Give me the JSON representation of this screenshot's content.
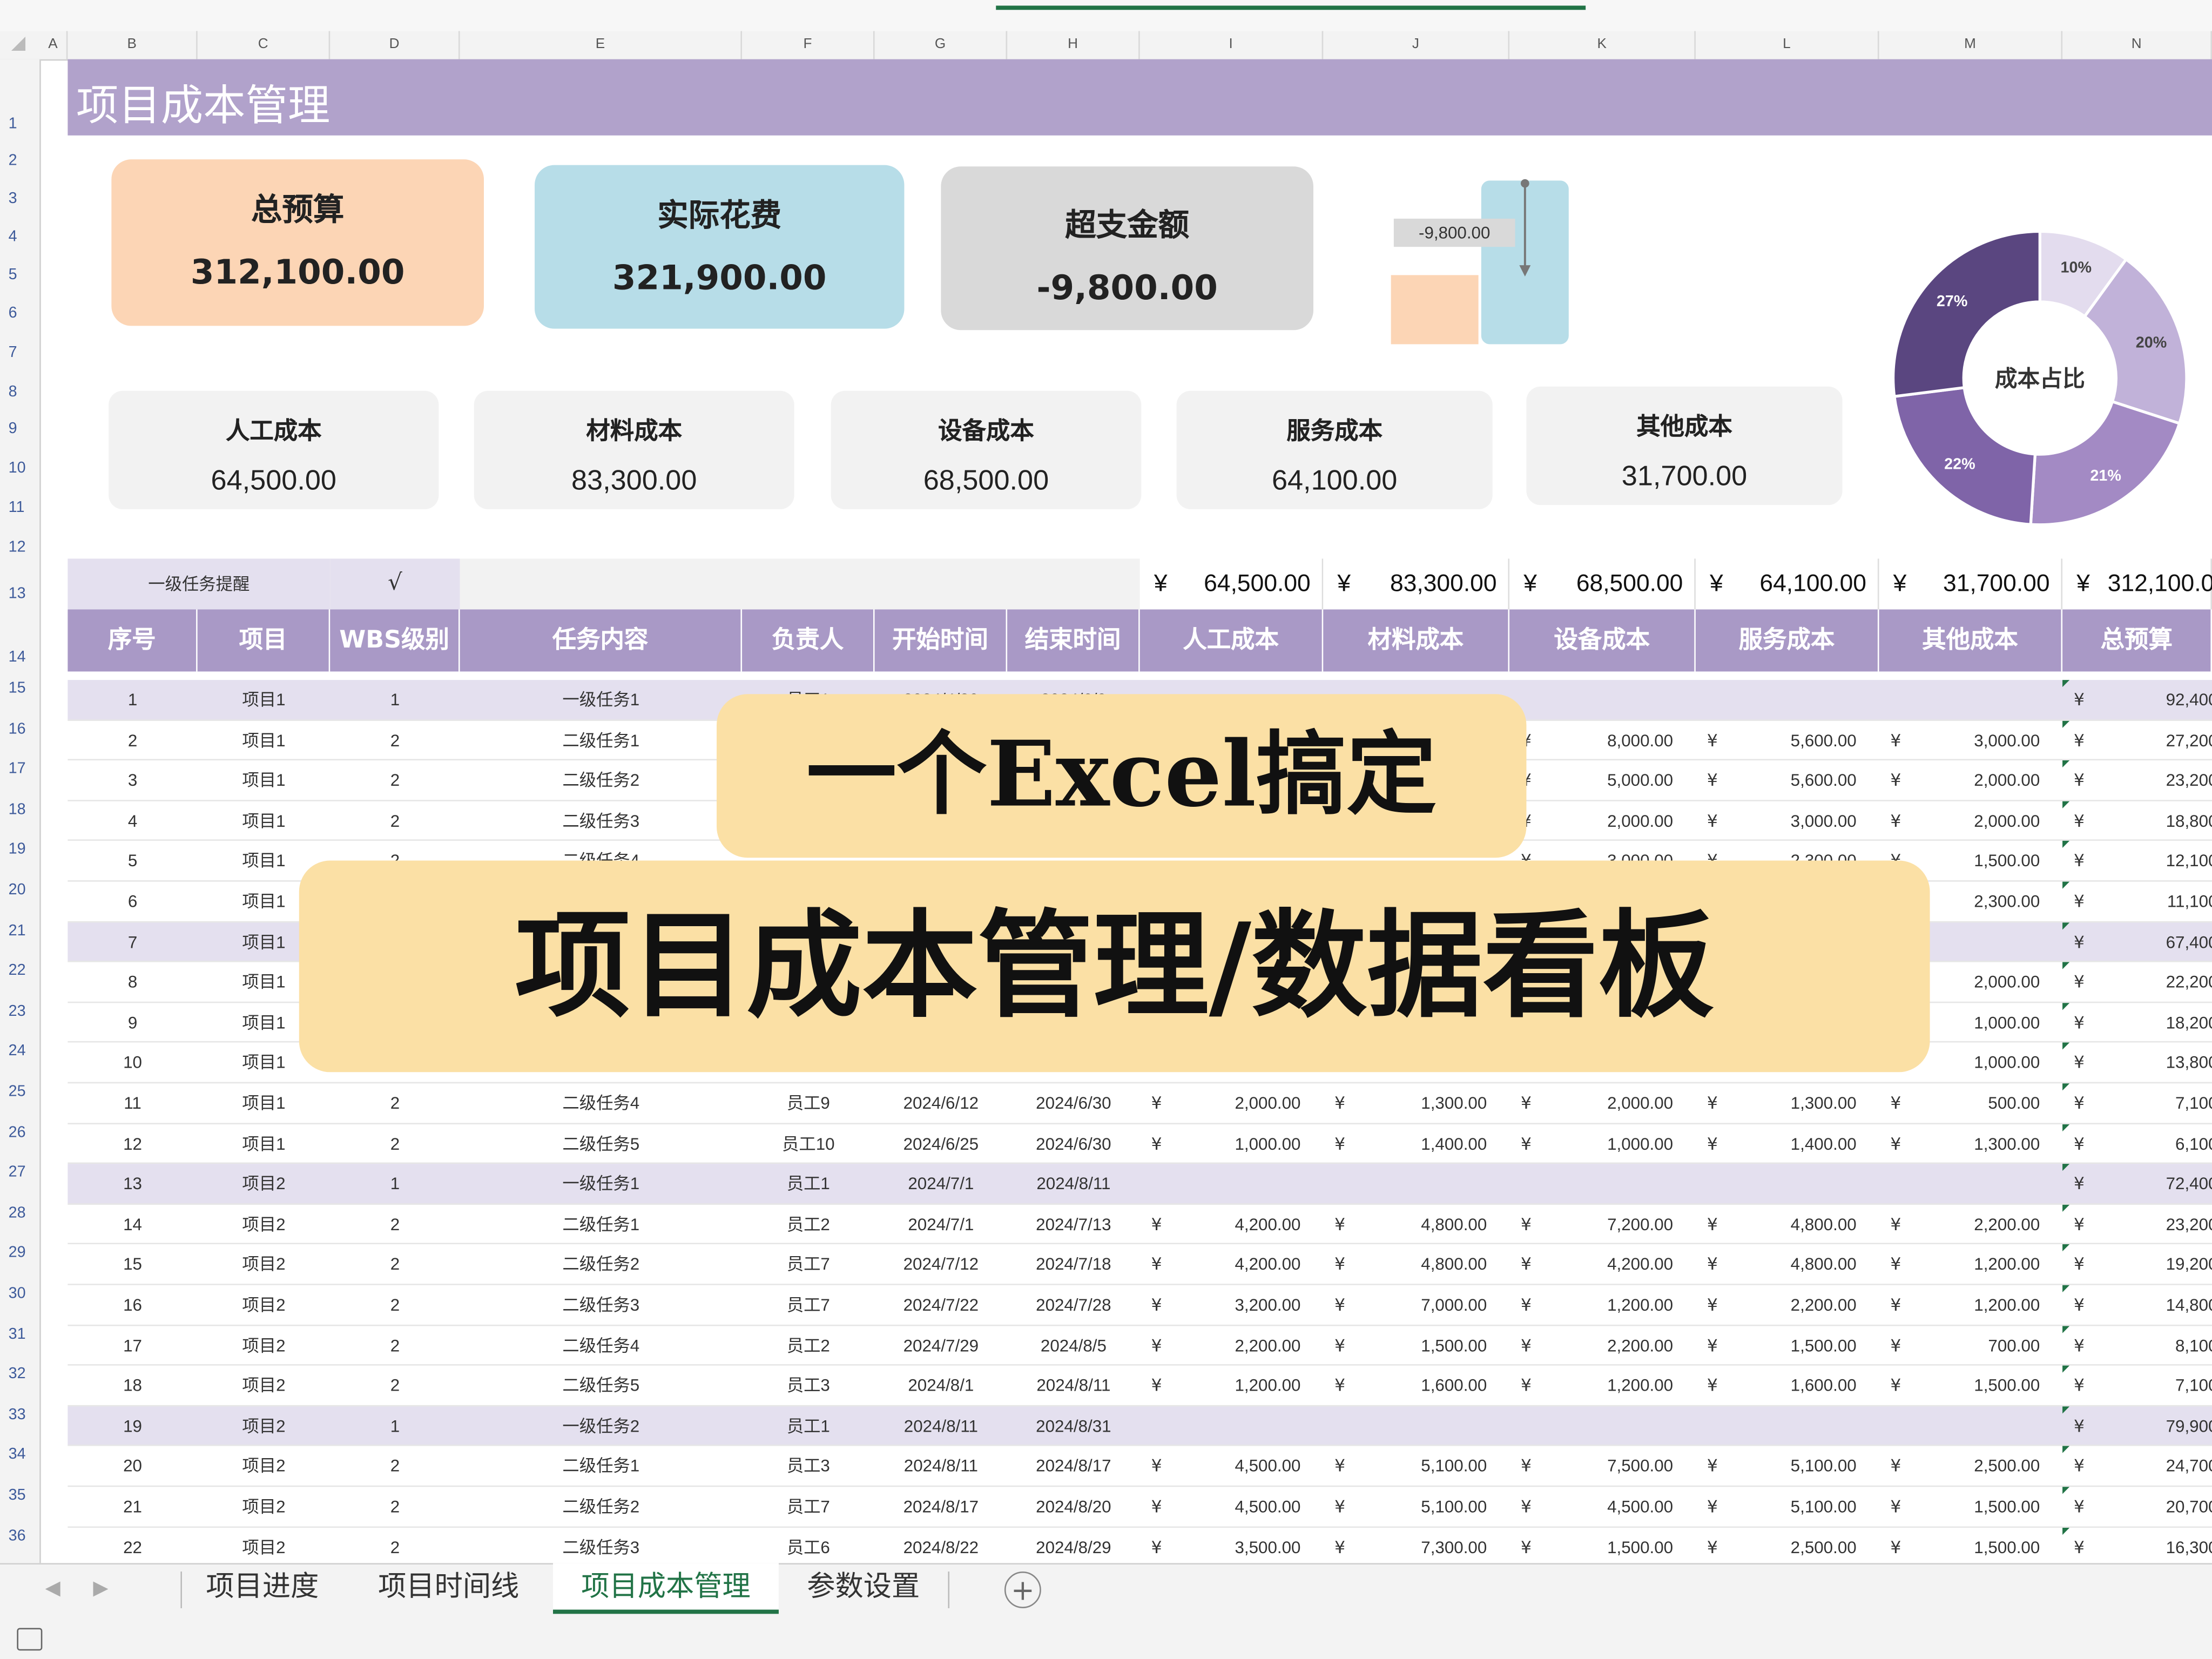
{
  "column_letters": [
    "A",
    "B",
    "C",
    "D",
    "E",
    "F",
    "G",
    "H",
    "I",
    "J",
    "K",
    "L",
    "M",
    "N"
  ],
  "row_numbers": [
    "1",
    "2",
    "3",
    "4",
    "5",
    "6",
    "7",
    "8",
    "9",
    "10",
    "11",
    "12",
    "13",
    "14",
    "15",
    "16",
    "17",
    "18",
    "19",
    "20",
    "21",
    "22",
    "23",
    "24",
    "25",
    "26",
    "27",
    "28",
    "29",
    "30",
    "31",
    "32",
    "33",
    "34",
    "35",
    "36"
  ],
  "title": "项目成本管理",
  "cards": [
    {
      "label": "总预算",
      "value": "312,100.00",
      "color": "#fcd5b5"
    },
    {
      "label": "实际花费",
      "value": "321,900.00",
      "color": "#b7dde8"
    },
    {
      "label": "超支金额",
      "value": "-9,800.00",
      "color": "#d9d9d9"
    }
  ],
  "bar_chart": {
    "label": "-9,800.00",
    "budget_fraction": 0.42,
    "actual_fraction": 1.0
  },
  "subcards": [
    {
      "label": "人工成本",
      "value": "64,500.00"
    },
    {
      "label": "材料成本",
      "value": "83,300.00"
    },
    {
      "label": "设备成本",
      "value": "68,500.00"
    },
    {
      "label": "服务成本",
      "value": "64,100.00"
    },
    {
      "label": "其他成本",
      "value": "31,700.00"
    }
  ],
  "donut": {
    "center_label": "成本占比",
    "slices": [
      {
        "label": "10%",
        "value": 10,
        "color": "#e3dcee"
      },
      {
        "label": "20%",
        "value": 20,
        "color": "#c1b2d9"
      },
      {
        "label": "21%",
        "value": 21,
        "color": "#a38ac4"
      },
      {
        "label": "22%",
        "value": 22,
        "color": "#7f64a8"
      },
      {
        "label": "27%",
        "value": 27,
        "color": "#5a4680"
      }
    ]
  },
  "table": {
    "filter_label": "一级任务提醒",
    "filter_check": "√",
    "totals_prefix": "¥",
    "totals": [
      "64,500.00",
      "83,300.00",
      "68,500.00",
      "64,100.00",
      "31,700.00",
      "312,100.00"
    ],
    "headers": [
      "序号",
      "项目",
      "WBS级别",
      "任务内容",
      "负责人",
      "开始时间",
      "结束时间",
      "人工成本",
      "材料成本",
      "设备成本",
      "服务成本",
      "其他成本",
      "总预算"
    ],
    "yen": "¥",
    "rows": [
      {
        "no": "1",
        "proj": "项目1",
        "lvl": "1",
        "task": "一级任务1",
        "owner": "员工1",
        "start": "2024/4/30",
        "end": "2024/6/9",
        "c1": "",
        "c2": "",
        "c3": "",
        "c4": "",
        "c5": "",
        "total": "92,400"
      },
      {
        "no": "2",
        "proj": "项目1",
        "lvl": "2",
        "task": "二级任务1",
        "owner": "",
        "start": "",
        "end": "",
        "c1": "",
        "c2": "",
        "c3": "8,000.00",
        "c4": "5,600.00",
        "c5": "3,000.00",
        "total": "27,200"
      },
      {
        "no": "3",
        "proj": "项目1",
        "lvl": "2",
        "task": "二级任务2",
        "owner": "",
        "start": "",
        "end": "",
        "c1": "",
        "c2": "",
        "c3": "5,000.00",
        "c4": "5,600.00",
        "c5": "2,000.00",
        "total": "23,200"
      },
      {
        "no": "4",
        "proj": "项目1",
        "lvl": "2",
        "task": "二级任务3",
        "owner": "",
        "start": "",
        "end": "",
        "c1": "",
        "c2": "",
        "c3": "2,000.00",
        "c4": "3,000.00",
        "c5": "2,000.00",
        "total": "18,800"
      },
      {
        "no": "5",
        "proj": "项目1",
        "lvl": "2",
        "task": "二级任务4",
        "owner": "",
        "start": "",
        "end": "",
        "c1": "",
        "c2": "",
        "c3": "3,000.00",
        "c4": "2,300.00",
        "c5": "1,500.00",
        "total": "12,100"
      },
      {
        "no": "6",
        "proj": "项目1",
        "lvl": "",
        "task": "",
        "owner": "",
        "start": "",
        "end": "",
        "c1": "",
        "c2": "",
        "c3": "",
        "c4": "",
        "c5": "2,300.00",
        "total": "11,100"
      },
      {
        "no": "7",
        "proj": "项目1",
        "lvl": "",
        "task": "",
        "owner": "",
        "start": "",
        "end": "",
        "c1": "",
        "c2": "",
        "c3": "",
        "c4": "",
        "c5": "",
        "total": "67,400"
      },
      {
        "no": "8",
        "proj": "项目1",
        "lvl": "",
        "task": "",
        "owner": "",
        "start": "",
        "end": "",
        "c1": "",
        "c2": "",
        "c3": "",
        "c4": "",
        "c5": "2,000.00",
        "total": "22,200"
      },
      {
        "no": "9",
        "proj": "项目1",
        "lvl": "",
        "task": "",
        "owner": "",
        "start": "",
        "end": "",
        "c1": "",
        "c2": "",
        "c3": "",
        "c4": "",
        "c5": "1,000.00",
        "total": "18,200"
      },
      {
        "no": "10",
        "proj": "项目1",
        "lvl": "",
        "task": "",
        "owner": "",
        "start": "",
        "end": "",
        "c1": "",
        "c2": "",
        "c3": "",
        "c4": "",
        "c5": "1,000.00",
        "total": "13,800"
      },
      {
        "no": "11",
        "proj": "项目1",
        "lvl": "2",
        "task": "二级任务4",
        "owner": "员工9",
        "start": "2024/6/12",
        "end": "2024/6/30",
        "c1": "2,000.00",
        "c2": "1,300.00",
        "c3": "2,000.00",
        "c4": "1,300.00",
        "c5": "500.00",
        "total": "7,100"
      },
      {
        "no": "12",
        "proj": "项目1",
        "lvl": "2",
        "task": "二级任务5",
        "owner": "员工10",
        "start": "2024/6/25",
        "end": "2024/6/30",
        "c1": "1,000.00",
        "c2": "1,400.00",
        "c3": "1,000.00",
        "c4": "1,400.00",
        "c5": "1,300.00",
        "total": "6,100"
      },
      {
        "no": "13",
        "proj": "项目2",
        "lvl": "1",
        "task": "一级任务1",
        "owner": "员工1",
        "start": "2024/7/1",
        "end": "2024/8/11",
        "c1": "",
        "c2": "",
        "c3": "",
        "c4": "",
        "c5": "",
        "total": "72,400"
      },
      {
        "no": "14",
        "proj": "项目2",
        "lvl": "2",
        "task": "二级任务1",
        "owner": "员工2",
        "start": "2024/7/1",
        "end": "2024/7/13",
        "c1": "4,200.00",
        "c2": "4,800.00",
        "c3": "7,200.00",
        "c4": "4,800.00",
        "c5": "2,200.00",
        "total": "23,200"
      },
      {
        "no": "15",
        "proj": "项目2",
        "lvl": "2",
        "task": "二级任务2",
        "owner": "员工7",
        "start": "2024/7/12",
        "end": "2024/7/18",
        "c1": "4,200.00",
        "c2": "4,800.00",
        "c3": "4,200.00",
        "c4": "4,800.00",
        "c5": "1,200.00",
        "total": "19,200"
      },
      {
        "no": "16",
        "proj": "项目2",
        "lvl": "2",
        "task": "二级任务3",
        "owner": "员工7",
        "start": "2024/7/22",
        "end": "2024/7/28",
        "c1": "3,200.00",
        "c2": "7,000.00",
        "c3": "1,200.00",
        "c4": "2,200.00",
        "c5": "1,200.00",
        "total": "14,800"
      },
      {
        "no": "17",
        "proj": "项目2",
        "lvl": "2",
        "task": "二级任务4",
        "owner": "员工2",
        "start": "2024/7/29",
        "end": "2024/8/5",
        "c1": "2,200.00",
        "c2": "1,500.00",
        "c3": "2,200.00",
        "c4": "1,500.00",
        "c5": "700.00",
        "total": "8,100"
      },
      {
        "no": "18",
        "proj": "项目2",
        "lvl": "2",
        "task": "二级任务5",
        "owner": "员工3",
        "start": "2024/8/1",
        "end": "2024/8/11",
        "c1": "1,200.00",
        "c2": "1,600.00",
        "c3": "1,200.00",
        "c4": "1,600.00",
        "c5": "1,500.00",
        "total": "7,100"
      },
      {
        "no": "19",
        "proj": "项目2",
        "lvl": "1",
        "task": "一级任务2",
        "owner": "员工1",
        "start": "2024/8/11",
        "end": "2024/8/31",
        "c1": "",
        "c2": "",
        "c3": "",
        "c4": "",
        "c5": "",
        "total": "79,900"
      },
      {
        "no": "20",
        "proj": "项目2",
        "lvl": "2",
        "task": "二级任务1",
        "owner": "员工3",
        "start": "2024/8/11",
        "end": "2024/8/17",
        "c1": "4,500.00",
        "c2": "5,100.00",
        "c3": "7,500.00",
        "c4": "5,100.00",
        "c5": "2,500.00",
        "total": "24,700"
      },
      {
        "no": "21",
        "proj": "项目2",
        "lvl": "2",
        "task": "二级任务2",
        "owner": "员工7",
        "start": "2024/8/17",
        "end": "2024/8/20",
        "c1": "4,500.00",
        "c2": "5,100.00",
        "c3": "4,500.00",
        "c4": "5,100.00",
        "c5": "1,500.00",
        "total": "20,700"
      },
      {
        "no": "22",
        "proj": "项目2",
        "lvl": "2",
        "task": "二级任务3",
        "owner": "员工6",
        "start": "2024/8/22",
        "end": "2024/8/29",
        "c1": "3,500.00",
        "c2": "7,300.00",
        "c3": "1,500.00",
        "c4": "2,500.00",
        "c5": "1,500.00",
        "total": "16,300"
      }
    ]
  },
  "overlay": {
    "line1": "一个Excel搞定",
    "line2": "项目成本管理/数据看板"
  },
  "tabs": [
    "项目进度",
    "项目时间线",
    "项目成本管理",
    "参数设置"
  ],
  "active_tab": "项目成本管理",
  "add_sheet": "+"
}
